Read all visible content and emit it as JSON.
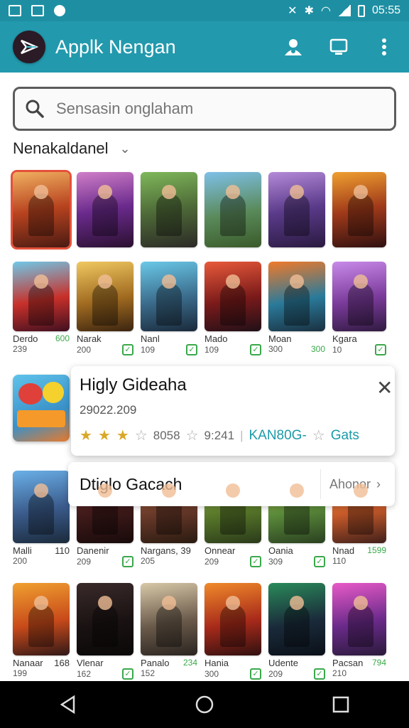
{
  "status_bar": {
    "time": "05:55"
  },
  "app_bar": {
    "title": "Applk Nengan"
  },
  "search": {
    "placeholder": "Sensasin onglaham"
  },
  "category": {
    "label": "Nenakaldanel"
  },
  "colors": {
    "primary": "#2299ad",
    "status": "#1e8fa3",
    "accent_green": "#3aa84a",
    "link": "#1b9aa8"
  },
  "row1": [
    {
      "name": "",
      "meta": "",
      "price": ""
    },
    {
      "name": "",
      "meta": "",
      "price": ""
    },
    {
      "name": "",
      "meta": "",
      "price": ""
    },
    {
      "name": "",
      "meta": "",
      "price": ""
    },
    {
      "name": "",
      "meta": "",
      "price": ""
    },
    {
      "name": "",
      "meta": "",
      "price": ""
    }
  ],
  "row2": [
    {
      "name": "Derdo",
      "meta": "239",
      "price": "600"
    },
    {
      "name": "Narak",
      "meta": "200",
      "price": ""
    },
    {
      "name": "Nanl",
      "meta": "109",
      "price": ""
    },
    {
      "name": "Mado",
      "meta": "109",
      "price": ""
    },
    {
      "name": "Moan",
      "meta": "300",
      "price": "300"
    },
    {
      "name": "Kgara",
      "meta": "10",
      "price": ""
    }
  ],
  "popup": {
    "title": "Higly Gideaha",
    "subtitle": "29022.209",
    "rating_a": "8058",
    "rating_b": "9:241",
    "link": "KAN80G-",
    "link2": "Gats"
  },
  "banner": {
    "title": "Dtiglo Gacach",
    "button": "Ahonor"
  },
  "row3": [
    {
      "name": "Malli",
      "meta": "200",
      "price": "110"
    },
    {
      "name": "Danenir",
      "meta": "209",
      "price": ""
    },
    {
      "name": "Nargans, 39",
      "meta": "205",
      "price": ""
    },
    {
      "name": "Onnear",
      "meta": "209",
      "price": ""
    },
    {
      "name": "Oania",
      "meta": "309",
      "price": ""
    },
    {
      "name": "Nnad",
      "meta": "110",
      "price": "1599"
    }
  ],
  "row4": [
    {
      "name": "Nanaar",
      "meta": "199",
      "price": "168"
    },
    {
      "name": "Vlenar",
      "meta": "162",
      "price": ""
    },
    {
      "name": "Panalo",
      "meta": "152",
      "price": "234"
    },
    {
      "name": "Hania",
      "meta": "300",
      "price": ""
    },
    {
      "name": "Udente",
      "meta": "209",
      "price": ""
    },
    {
      "name": "Pacsan",
      "meta": "210",
      "price": "794"
    }
  ]
}
